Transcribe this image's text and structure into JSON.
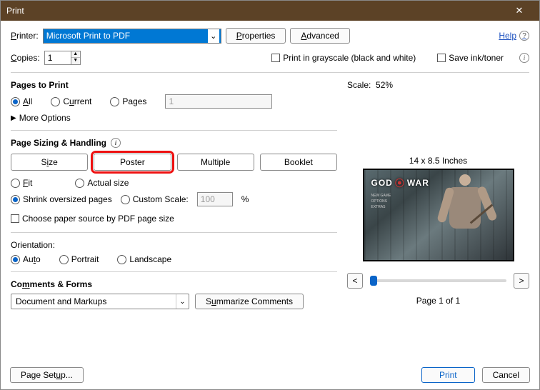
{
  "window": {
    "title": "Print"
  },
  "header": {
    "printer_label": "Printer:",
    "printer_value": "Microsoft Print to PDF",
    "properties_btn": "Properties",
    "advanced_btn": "Advanced",
    "help_label": "Help"
  },
  "copies": {
    "label": "Copies:",
    "value": "1",
    "grayscale_label": "Print in grayscale (black and white)",
    "saveink_label": "Save ink/toner"
  },
  "pages": {
    "title": "Pages to Print",
    "all": "All",
    "current": "Current",
    "pages": "Pages",
    "pages_value": "1",
    "more": "More Options"
  },
  "sizing": {
    "title": "Page Sizing & Handling",
    "tabs": {
      "size": "Size",
      "poster": "Poster",
      "multiple": "Multiple",
      "booklet": "Booklet"
    },
    "fit": "Fit",
    "actual": "Actual size",
    "shrink": "Shrink oversized pages",
    "custom": "Custom Scale:",
    "custom_value": "100",
    "custom_unit": "%",
    "choose_paper": "Choose paper source by PDF page size"
  },
  "orient": {
    "title": "Orientation:",
    "auto": "Auto",
    "portrait": "Portrait",
    "landscape": "Landscape"
  },
  "comments": {
    "title": "Comments & Forms",
    "value": "Document and Markups",
    "summarize": "Summarize Comments"
  },
  "preview": {
    "scale_label": "Scale:",
    "scale_value": "52%",
    "dimensions": "14 x 8.5 Inches",
    "logo1": "GOD",
    "logo2": "WAR",
    "prev_btn": "<",
    "next_btn": ">",
    "page_of": "Page 1 of 1"
  },
  "footer": {
    "page_setup": "Page Setup...",
    "print": "Print",
    "cancel": "Cancel"
  }
}
